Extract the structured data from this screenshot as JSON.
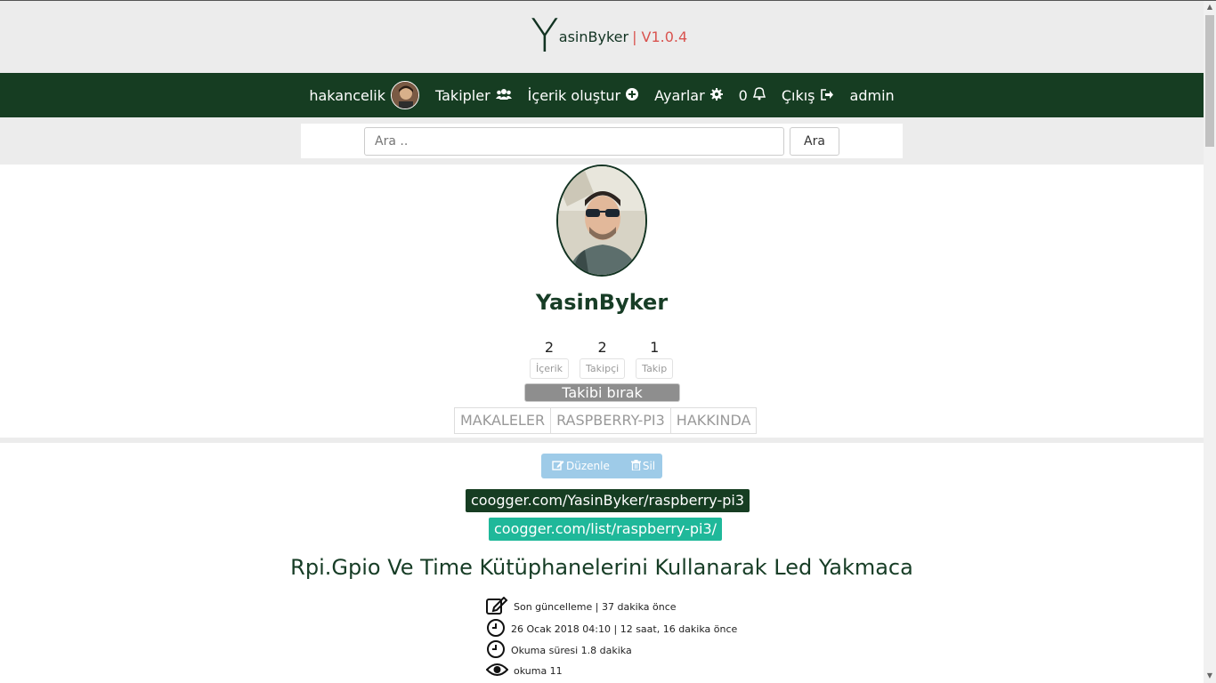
{
  "brand": {
    "logo_letter": "Y",
    "name_rest": "asinByker",
    "version": "| V1.0.4"
  },
  "nav": {
    "user": "hakancelik",
    "followers": "Takipler",
    "create": "İçerik oluştur",
    "settings": "Ayarlar",
    "notifications": "0",
    "logout": "Çıkış",
    "admin": "admin"
  },
  "search": {
    "placeholder": "Ara ..",
    "button": "Ara"
  },
  "profile": {
    "username": "YasinByker",
    "stats": [
      {
        "value": "2",
        "label": "İçerik"
      },
      {
        "value": "2",
        "label": "Takipçi"
      },
      {
        "value": "1",
        "label": "Takip"
      }
    ],
    "unfollow": "Takibi bırak",
    "tabs": [
      "MAKALELER",
      "RASPBERRY-PI3",
      "HAKKINDA"
    ]
  },
  "post": {
    "edit": "Düzenle",
    "delete": "Sil",
    "link_user": "coogger.com/YasinByker/raspberry-pi3",
    "link_list": "coogger.com/list/raspberry-pi3/",
    "title": "Rpi.Gpio Ve Time Kütüphanelerini Kullanarak Led Yakmaca",
    "meta": {
      "updated": "Son güncelleme | 37 dakika önce",
      "date": "26 Ocak 2018 04:10 | 12 saat, 16 dakika önce",
      "read_time": "Okuma süresi 1.8 dakika",
      "views": "okuma 11"
    }
  },
  "colors": {
    "primary": "#163d22",
    "accent": "#1fb89a",
    "version": "#d9534f"
  }
}
